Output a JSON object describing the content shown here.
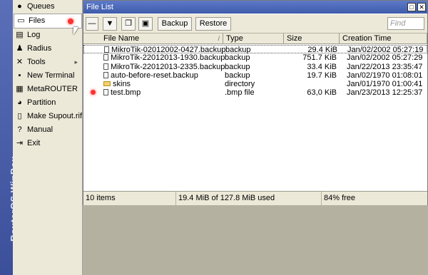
{
  "brand": {
    "text": "RouterOS WinBox"
  },
  "sidebar": {
    "items": [
      {
        "label": "Queues",
        "icon": "queues-icon"
      },
      {
        "label": "Files",
        "icon": "files-icon"
      },
      {
        "label": "Log",
        "icon": "log-icon"
      },
      {
        "label": "Radius",
        "icon": "radius-icon"
      },
      {
        "label": "Tools",
        "icon": "tools-icon"
      },
      {
        "label": "New Terminal",
        "icon": "terminal-icon"
      },
      {
        "label": "MetaROUTER",
        "icon": "metarouter-icon"
      },
      {
        "label": "Partition",
        "icon": "partition-icon"
      },
      {
        "label": "Make Supout.rif",
        "icon": "supout-icon"
      },
      {
        "label": "Manual",
        "icon": "manual-icon"
      },
      {
        "label": "Exit",
        "icon": "exit-icon"
      }
    ],
    "tools_arrow": "▸"
  },
  "window": {
    "title": "File List",
    "toolbar": {
      "backup_label": "Backup",
      "restore_label": "Restore",
      "find_placeholder": "Find"
    },
    "columns": [
      "File Name",
      "Type",
      "Size",
      "Creation Time"
    ],
    "sort_indicator": "/",
    "rows": [
      {
        "name": "MikroTik-02012002-0427.backup",
        "type": "backup",
        "size": "29.4 KiB",
        "created": "Jan/02/2002 05:27:19",
        "kind": "file"
      },
      {
        "name": "MikroTik-22012013-1930.backup",
        "type": "backup",
        "size": "751.7 KiB",
        "created": "Jan/02/2002 05:27:29",
        "kind": "file"
      },
      {
        "name": "MikroTik-22012013-2335.backup",
        "type": "backup",
        "size": "33.4 KiB",
        "created": "Jan/22/2013 23:35:47",
        "kind": "file"
      },
      {
        "name": "auto-before-reset.backup",
        "type": "backup",
        "size": "19.7 KiB",
        "created": "Jan/02/1970 01:08:01",
        "kind": "file"
      },
      {
        "name": "skins",
        "type": "directory",
        "size": "",
        "created": "Jan/01/1970 01:00:41",
        "kind": "folder"
      },
      {
        "name": "test.bmp",
        "type": ".bmp file",
        "size": "63,0 KiB",
        "created": "Jan/23/2013 12:25:37",
        "kind": "file"
      }
    ],
    "status": {
      "count": "10 items",
      "usage": "19.4 MiB of 127.8 MiB used",
      "free": "84% free"
    }
  },
  "colors": {
    "brand": "#3c4f9a",
    "titlebar": "#4a68b8",
    "accent_dot": "#ff3030"
  }
}
